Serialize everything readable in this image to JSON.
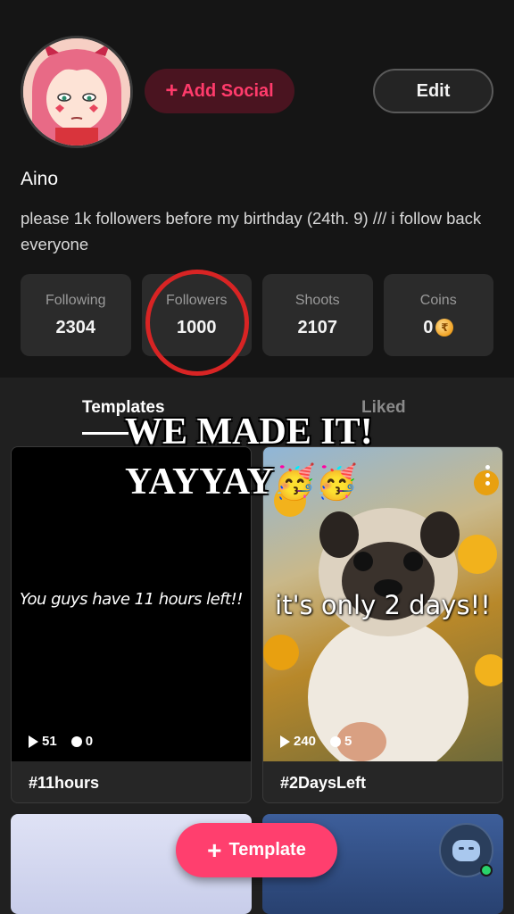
{
  "profile": {
    "username": "Aino",
    "bio": "please 1k followers before my birthday (24th. 9)  ///  i follow back everyone",
    "add_social_label": "Add Social",
    "edit_label": "Edit"
  },
  "stats": [
    {
      "label": "Following",
      "value": "2304"
    },
    {
      "label": "Followers",
      "value": "1000"
    },
    {
      "label": "Shoots",
      "value": "2107"
    },
    {
      "label": "Coins",
      "value": "0"
    }
  ],
  "tabs": [
    {
      "label": "Templates",
      "active": true
    },
    {
      "label": "Liked",
      "active": false
    }
  ],
  "overlay": {
    "line1": "WE MADE IT!",
    "line2": "YAYYAY",
    "emoji": "🥳🥳"
  },
  "cards": [
    {
      "overlay_text": "You guys have 11 hours left!!",
      "plays": "51",
      "comments": "0",
      "caption": "#11hours"
    },
    {
      "overlay_text": "it's only 2 days!!",
      "plays": "240",
      "comments": "5",
      "caption": "#2DaysLeft"
    }
  ],
  "fab": {
    "label": "Template"
  },
  "colors": {
    "accent": "#ff3f6e",
    "background": "#161616",
    "highlight_circle": "#d82424"
  },
  "icons": [
    "plus-icon",
    "play-icon",
    "comment-icon",
    "more-icon",
    "coin-icon",
    "assistant-bot-icon"
  ]
}
